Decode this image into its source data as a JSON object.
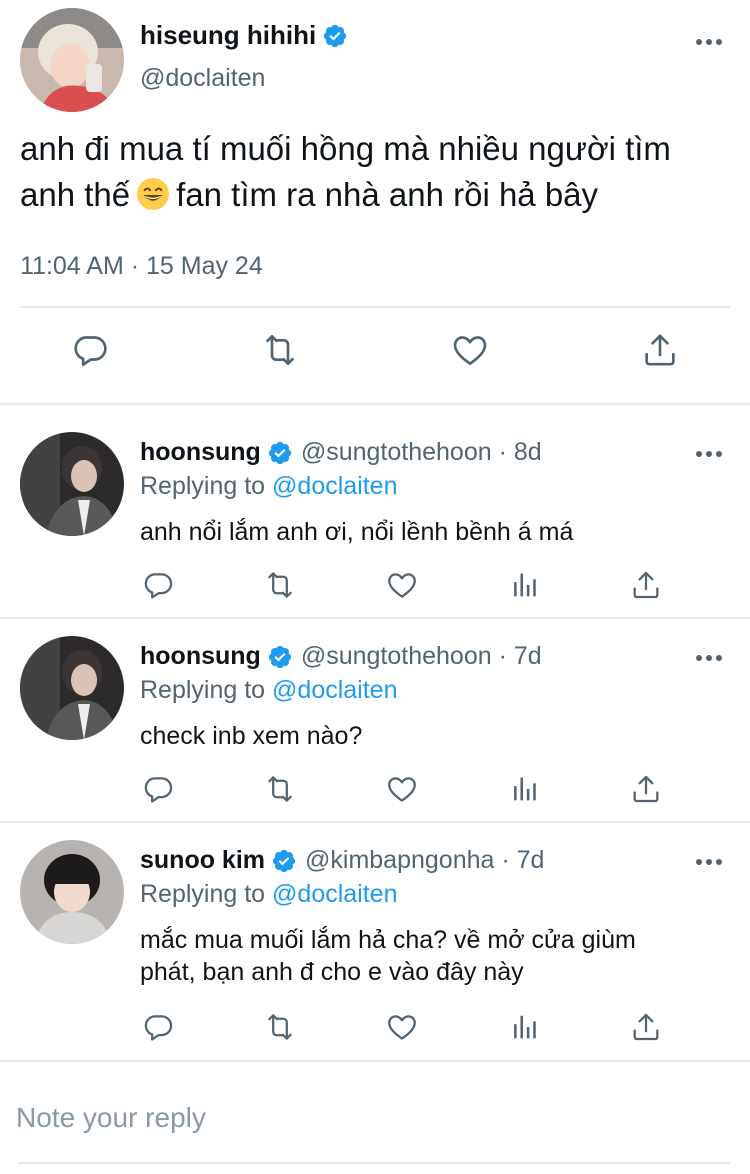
{
  "main_tweet": {
    "name": "hiseung hihihi",
    "handle": "@doclaiten",
    "text_before_emoji": "anh đi mua tí muối hồng mà nhiều người tìm anh thế",
    "emoji": "grinning-face-with-smiling-eyes",
    "text_after_emoji": "fan tìm ra nhà anh rồi hả bây",
    "timestamp": "11:04 AM · 15 May 24",
    "actions": [
      "reply-icon",
      "retweet-icon",
      "like-icon",
      "share-icon"
    ]
  },
  "replies": [
    {
      "name": "hoonsung",
      "handle_time": "@sungtothehoon · 8d",
      "replying_prefix": "Replying to",
      "mention": "@doclaiten",
      "text": "anh nổi lắm anh ơi, nổi lềnh bềnh á má"
    },
    {
      "name": "hoonsung",
      "handle_time": "@sungtothehoon · 7d",
      "replying_prefix": "Replying to",
      "mention": "@doclaiten",
      "text": "check inb xem nào?"
    },
    {
      "name": "sunoo kim",
      "handle_time": "@kimbapngonha · 7d",
      "replying_prefix": "Replying to",
      "mention": "@doclaiten",
      "text_line1": "mắc mua muối lắm hả cha? về mở cửa giùm",
      "text_line2": "phát, bạn anh đ cho e vào đây này"
    }
  ],
  "reply_box": {
    "placeholder": "Note your reply"
  },
  "colors": {
    "text": "#0f1419",
    "secondary": "#536471",
    "link": "#1d9bf0",
    "verified": "#1d9bf0",
    "divider": "#e6e9ec"
  }
}
